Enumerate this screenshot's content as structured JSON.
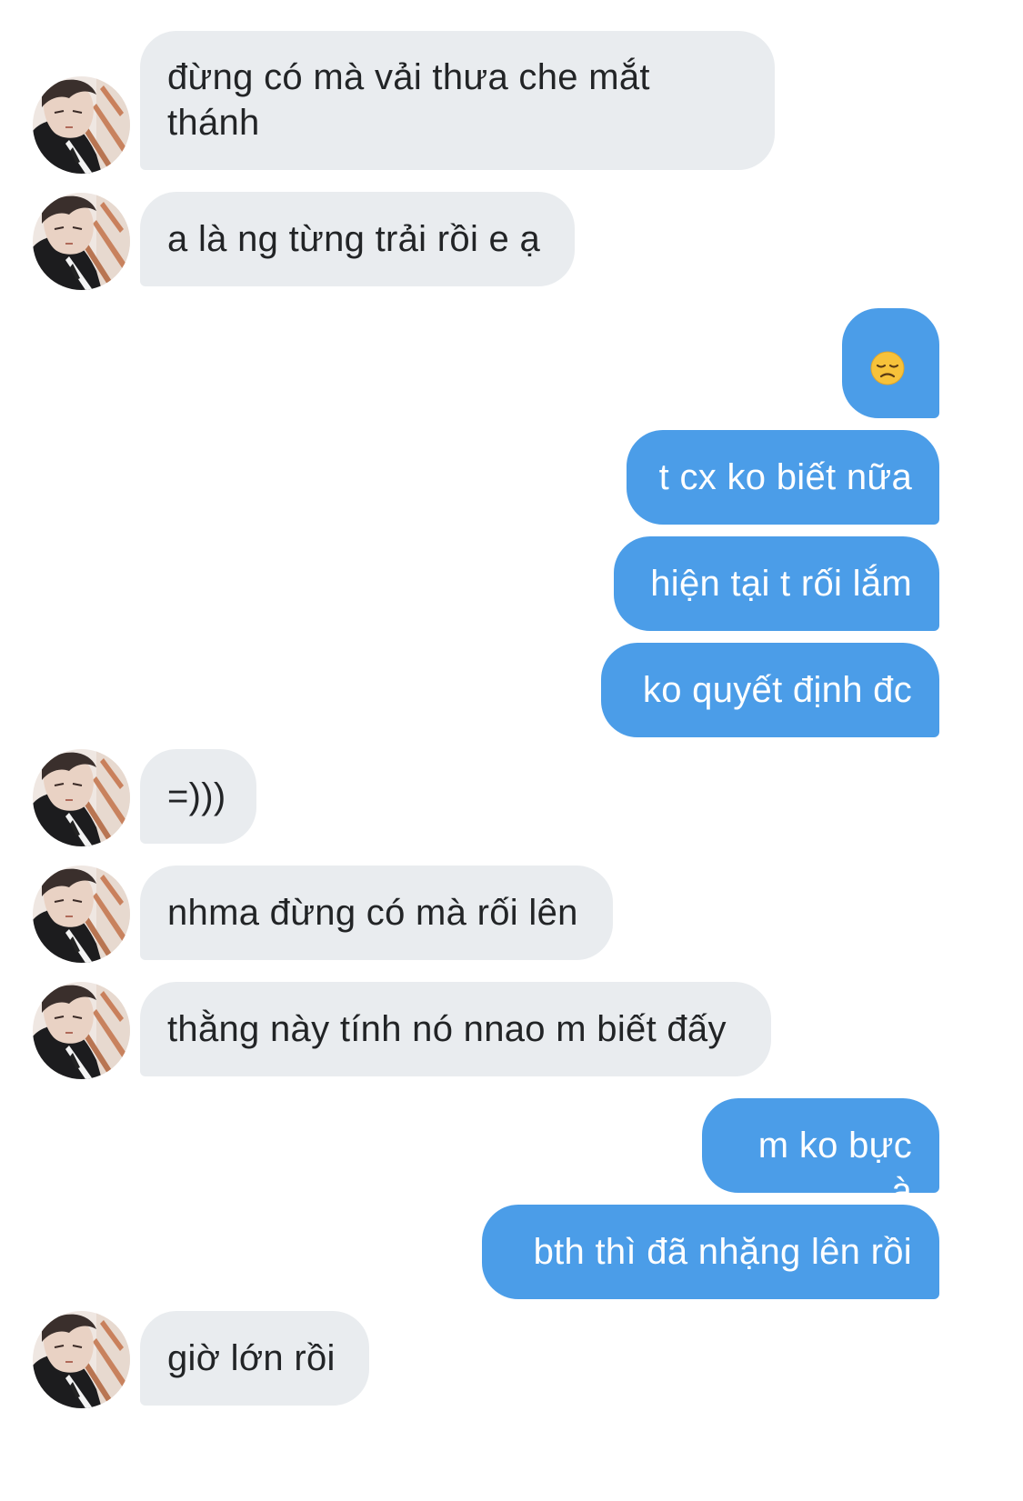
{
  "conversation": {
    "incoming": [
      {
        "text": "đừng có mà vải thưa che mắt thánh"
      },
      {
        "text": "a là ng từng trải rồi e ạ"
      },
      {
        "text": "=)))"
      },
      {
        "text": "nhma đừng có mà rối lên"
      },
      {
        "text": "thằng này tính nó nnao m biết đấy"
      },
      {
        "text": "giờ lớn rồi"
      }
    ],
    "outgoing": [
      {
        "emoji": "disappointed-face"
      },
      {
        "text": "t cx ko biết nữa"
      },
      {
        "text": "hiện tại t rối lắm"
      },
      {
        "text": "ko quyết định đc"
      },
      {
        "text": "m ko bực à"
      },
      {
        "text": "bth thì đã nhặng lên rồi"
      }
    ]
  },
  "colors": {
    "incoming_bubble": "#e9ecef",
    "incoming_text": "#222426",
    "outgoing_bubble": "#4b9de8",
    "outgoing_text": "#ffffff",
    "background": "#ffffff"
  },
  "icons": {
    "avatar": "contact-avatar-photo"
  }
}
